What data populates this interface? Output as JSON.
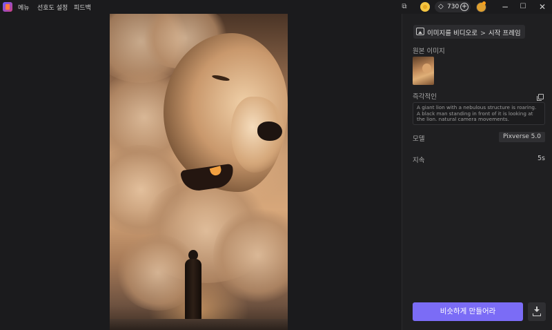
{
  "menu": {
    "items": [
      "메뉴",
      "선호도 설정",
      "피드백"
    ]
  },
  "topbar": {
    "credits": "730",
    "icons": [
      "app-logo-icon",
      "screen-icon",
      "coin-icon",
      "gem-icon",
      "plus-icon",
      "avatar-icon"
    ]
  },
  "window_controls": {
    "minimize": "−",
    "maximize": "☐",
    "close": "✕"
  },
  "panel": {
    "breadcrumb": {
      "mode": "이미지를 비디오로",
      "separator": ">",
      "current": "시작 프레임"
    },
    "source_image_label": "원본 이미지",
    "prompt_label": "즉각적인",
    "prompt_text": "A giant lion with a nebulous structure is roaring. A black man standing in front of it is looking at the lion. natural camera movements.",
    "model_label": "모델",
    "model_value": "Pixverse 5.0",
    "duration_label": "지속",
    "duration_value": "5s",
    "generate_button": "비슷하게 만들어라"
  },
  "colors": {
    "accent": "#7b6cf6",
    "background": "#1b1b1d",
    "panel": "#1f1f21"
  }
}
